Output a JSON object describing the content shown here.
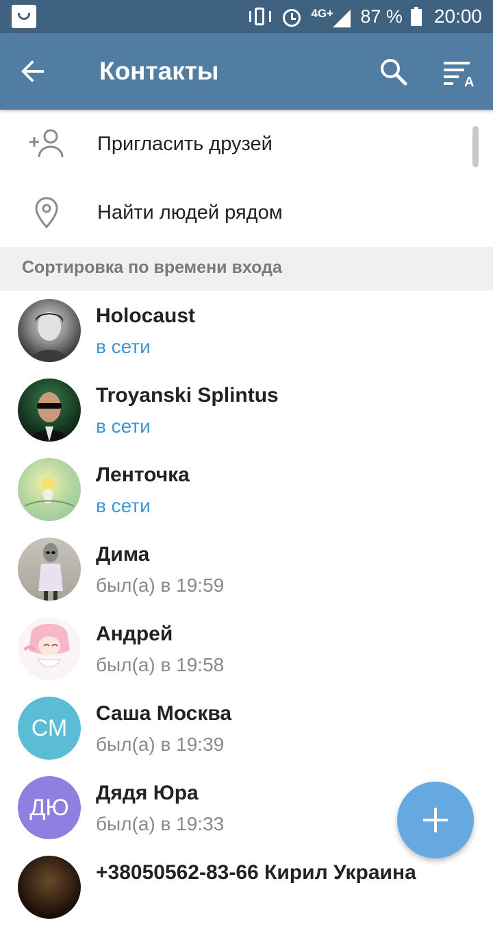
{
  "statusbar": {
    "network_label": "4G+",
    "battery_percent": "87 %",
    "time": "20:00",
    "icons": [
      "store-icon",
      "vibrate-icon",
      "alarm-icon",
      "signal-icon",
      "battery-icon"
    ]
  },
  "appbar": {
    "title": "Контакты",
    "back_icon": "arrow-back-icon",
    "search_icon": "search-icon",
    "sort_icon": "sort-alpha-icon"
  },
  "menu": [
    {
      "label": "Пригласить друзей",
      "icon": "add-person-icon"
    },
    {
      "label": "Найти людей рядом",
      "icon": "location-pin-icon"
    }
  ],
  "section_header": "Сортировка по времени входа",
  "contacts": [
    {
      "name": "Holocaust",
      "status": "в сети",
      "online": true
    },
    {
      "name": "Troyanski Splintus",
      "status": "в сети",
      "online": true
    },
    {
      "name": "Ленточка",
      "status": "в сети",
      "online": true
    },
    {
      "name": "Дима",
      "status": "был(а) в 19:59",
      "online": false
    },
    {
      "name": "Андрей",
      "status": "был(а) в 19:58",
      "online": false
    },
    {
      "name": "Саша Москва",
      "status": "был(а) в 19:39",
      "online": false,
      "initials": "СМ",
      "avatar_color": "#5bbcd6"
    },
    {
      "name": "Дядя Юра",
      "status": "был(а) в 19:33",
      "online": false,
      "initials": "ДЮ",
      "avatar_color": "#8e7fe0"
    },
    {
      "name": "+38050562-83-66 Кирил Украина",
      "status": "",
      "online": false
    }
  ],
  "colors": {
    "statusbar": "#3f6281",
    "appbar": "#527da3",
    "online": "#3d95d3",
    "fab": "#65a9e0"
  }
}
